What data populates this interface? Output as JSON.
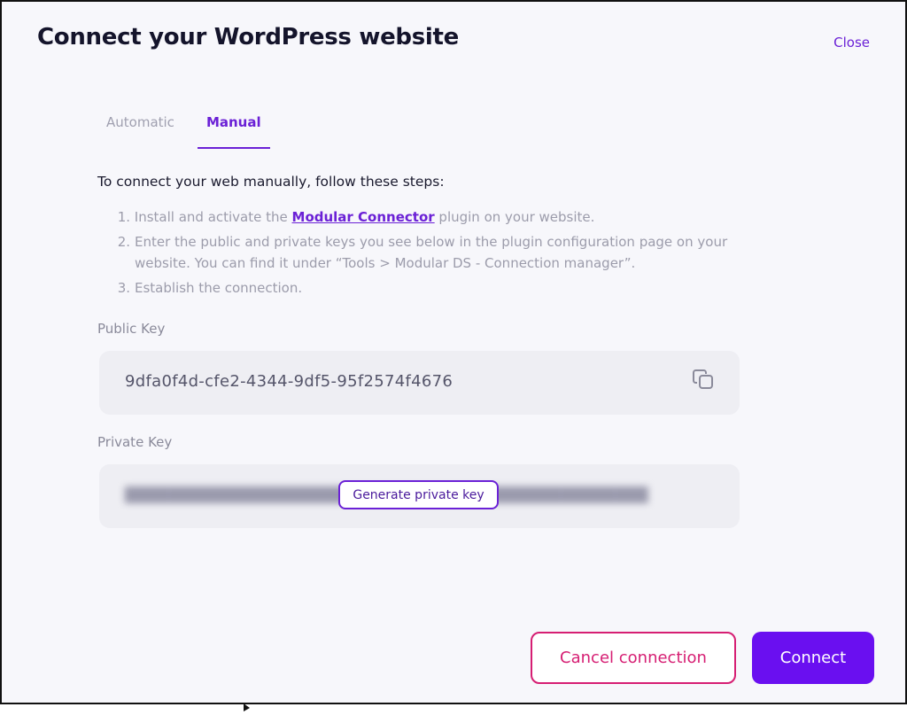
{
  "header": {
    "title": "Connect your WordPress website",
    "close_label": "Close"
  },
  "tabs": [
    {
      "label": "Automatic",
      "active": false
    },
    {
      "label": "Manual",
      "active": true
    }
  ],
  "instructions": {
    "intro": "To connect your web manually, follow these steps:",
    "steps": [
      {
        "number": "1.",
        "before": "Install and activate the ",
        "link": "Modular Connector",
        "after": " plugin on your website."
      },
      {
        "number": "2.",
        "text": "Enter the public and private keys you see below in the plugin configuration page on your website. You can find it under “Tools > Modular DS - Connection manager”."
      },
      {
        "number": "3.",
        "text": "Establish the connection."
      }
    ]
  },
  "public_key": {
    "label": "Public Key",
    "value": "9dfa0f4d-cfe2-4344-9df5-95f2574f4676",
    "copy_icon": "copy-icon"
  },
  "private_key": {
    "label": "Private Key",
    "generate_label": "Generate private key"
  },
  "footer": {
    "cancel_label": "Cancel connection",
    "connect_label": "Connect"
  },
  "colors": {
    "accent": "#6b21d6",
    "primary_button": "#6a0ff0",
    "danger": "#d61e73",
    "title": "#14142b",
    "muted": "#9c9cab"
  }
}
